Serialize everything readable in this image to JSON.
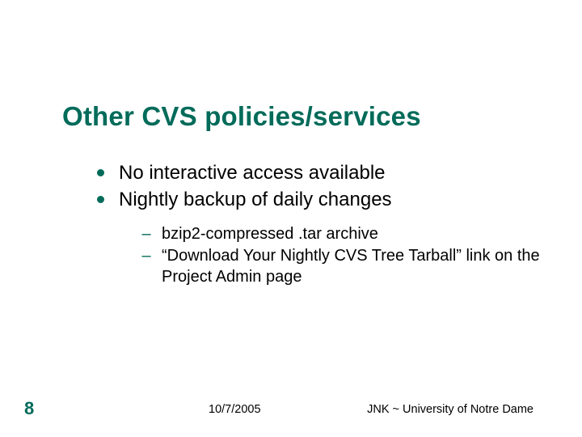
{
  "title": "Other CVS policies/services",
  "bullets": {
    "level1": [
      "No interactive access available",
      "Nightly backup of daily changes"
    ],
    "level2": [
      "bzip2-compressed .tar archive",
      "“Download Your Nightly CVS Tree Tarball” link on the Project Admin page"
    ]
  },
  "footer": {
    "page": "8",
    "date": "10/7/2005",
    "attribution": "JNK ~ University of Notre Dame"
  },
  "colors": {
    "accent": "#016b5a"
  }
}
